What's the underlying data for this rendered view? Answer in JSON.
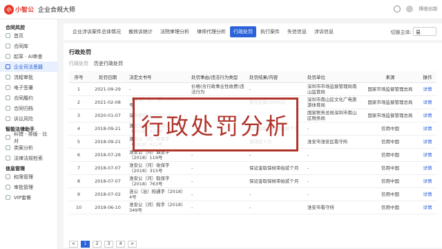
{
  "app": {
    "logo_text": "小智公",
    "app_name": "企业合规大师",
    "user_name": "博维创新"
  },
  "sidebar": {
    "groups": [
      {
        "title": "合同风控",
        "items": [
          {
            "label": "首页"
          },
          {
            "label": "合同库"
          },
          {
            "label": "起草 · AI审查"
          },
          {
            "label": "企业司法思籍"
          },
          {
            "label": "流程审批"
          },
          {
            "label": "电子签署"
          },
          {
            "label": "合同履约"
          },
          {
            "label": "合同归档"
          },
          {
            "label": "诉讼风险"
          }
        ]
      },
      {
        "title": "智能法律助手",
        "items": [
          {
            "label": "纠错 · 排版 · 比对"
          },
          {
            "label": "类案分析"
          },
          {
            "label": "法律法规检索"
          }
        ]
      },
      {
        "title": "信息管理",
        "items": [
          {
            "label": "权限管理"
          },
          {
            "label": "审批管理"
          },
          {
            "label": "VIP套餐"
          }
        ]
      }
    ],
    "active": "企业司法思籍"
  },
  "tabs": [
    "企业涉诉案件总体情况",
    "裁效诉统计",
    "法院审理分析",
    "律师代理分析",
    "行政处罚",
    "执行案件",
    "失信信息",
    "涉诉信息"
  ],
  "active_tab": "行政处罚",
  "switch": {
    "label": "切换主体:",
    "value": "易"
  },
  "section": {
    "title": "行政处罚",
    "subtabs": [
      "行政处罚",
      "历史行政处罚"
    ]
  },
  "table": {
    "headers": [
      "序号",
      "处罚日期",
      "决定文书号",
      "处罚事由/违法行为类型",
      "处罚结果/内容",
      "处罚单位",
      "来源",
      "操作"
    ],
    "rows": [
      [
        "1",
        "2021-09-29",
        "-",
        "价格(含行政事业性收费)违法行为",
        "-",
        "深圳市市场监督管理局南山监管局",
        "国家市场监督管理总局",
        "详情"
      ],
      [
        "2",
        "2021-02-08",
        "（深南）文… 第0128010…号",
        "-",
        "警告罚款10000元",
        "深圳市南山区文化广电旅游体育局",
        "国家市场监督管理总局",
        "详情"
      ],
      [
        "3",
        "2020-01-07",
        "深南税罚（2020）4…",
        "-",
        "-",
        "国家税务总局深圳市南山区税务局",
        "国家市场监督管理总局",
        "详情"
      ],
      [
        "4",
        "2018-09-21",
        "淮安公（河）收保字（2018）429号",
        "-",
        "保证金取保候审拍贰个月",
        "-",
        "信用中国",
        "详情"
      ],
      [
        "5",
        "2018-09-21",
        "淮安公（河）收保字（2018）412号",
        "-",
        "逮捕贰个月",
        "淮安市淮安区看守所",
        "信用中国",
        "详情"
      ],
      [
        "6",
        "2018-07-26",
        "淮安公（河）调证字（2018）119号",
        "-",
        "-",
        "-",
        "信用中国",
        "详情"
      ],
      [
        "7",
        "2018-07-07",
        "淮安公（河）收保字（2018）315号",
        "-",
        "保证金取保候审拍贰个月",
        "-",
        "信用中国",
        "详情"
      ],
      [
        "8",
        "2018-07-07",
        "淮安公（河）取保字（2018）763号",
        "-",
        "保证金取保候审拍贰个月",
        "-",
        "信用中国",
        "详情"
      ],
      [
        "9",
        "2018-07-02",
        "涟公（治）拘通字（2018）4号",
        "-",
        "-",
        "-",
        "信用中国",
        "详情"
      ],
      [
        "10",
        "2018-06-10",
        "淮安公（河）拘字（2018）349号",
        "-",
        "-",
        "淮安市看守所",
        "信用中国",
        "详情"
      ]
    ]
  },
  "overlay": {
    "text": "行政处罚分析"
  },
  "pager": {
    "pages": [
      "<",
      "1",
      "2",
      "3",
      "4",
      ">"
    ]
  }
}
